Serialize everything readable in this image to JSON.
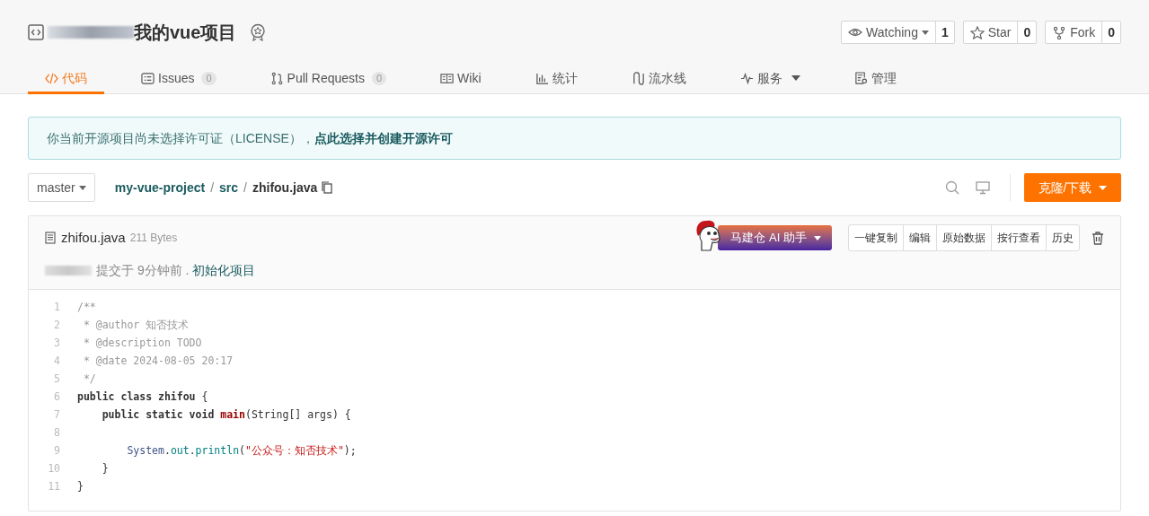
{
  "repo": {
    "title": "我的vue项目",
    "watch": {
      "label": "Watching",
      "count": "1"
    },
    "star": {
      "label": "Star",
      "count": "0"
    },
    "fork": {
      "label": "Fork",
      "count": "0"
    }
  },
  "tabs": [
    {
      "label": "代码",
      "selected": true
    },
    {
      "label": "Issues",
      "count": "0",
      "selected": false
    },
    {
      "label": "Pull Requests",
      "count": "0",
      "selected": false
    },
    {
      "label": "Wiki",
      "selected": false
    },
    {
      "label": "统计",
      "selected": false
    },
    {
      "label": "流水线",
      "selected": false
    },
    {
      "label": "服务",
      "dropdown": true,
      "selected": false
    },
    {
      "label": "管理",
      "selected": false
    }
  ],
  "notice": {
    "text": "你当前开源项目尚未选择许可证（LICENSE），",
    "link": "点此选择并创建开源许可"
  },
  "toolbar": {
    "branch": "master",
    "path": [
      {
        "name": "my-vue-project",
        "separator": "/"
      },
      {
        "name": "src",
        "separator": "/"
      }
    ],
    "file": "zhifou.java",
    "clone": "克隆/下载"
  },
  "file": {
    "name": "zhifou.java",
    "size": "211 Bytes",
    "ai": "马建仓 AI 助手",
    "actions": [
      "一键复制",
      "编辑",
      "原始数据",
      "按行查看",
      "历史"
    ],
    "commit": {
      "time": "提交于 9分钟前 .",
      "message": "初始化项目"
    }
  },
  "code": [
    {
      "number": "1",
      "tokens": [
        {
          "text": "/**",
          "kind": "comment"
        }
      ]
    },
    {
      "number": "2",
      "tokens": [
        {
          "text": " * @author 知否技术",
          "kind": "comment"
        }
      ]
    },
    {
      "number": "3",
      "tokens": [
        {
          "text": " * @description TODO",
          "kind": "comment"
        }
      ]
    },
    {
      "number": "4",
      "tokens": [
        {
          "text": " * @date 2024-08-05 20:17",
          "kind": "comment"
        }
      ]
    },
    {
      "number": "5",
      "tokens": [
        {
          "text": " */",
          "kind": "comment"
        }
      ]
    },
    {
      "number": "6",
      "tokens": [
        {
          "text": "public class zhifou",
          "kind": "keyword"
        },
        {
          "text": " {",
          "kind": "plain"
        }
      ]
    },
    {
      "number": "7",
      "tokens": [
        {
          "text": "    public static void ",
          "kind": "keyword"
        },
        {
          "text": "main",
          "kind": "method"
        },
        {
          "text": "(String[] args) {",
          "kind": "plain"
        }
      ]
    },
    {
      "number": "8"
    },
    {
      "number": "9",
      "tokens": [
        {
          "text": "        System",
          "kind": "type"
        },
        {
          "text": ".",
          "kind": "plain"
        },
        {
          "text": "out",
          "kind": "field"
        },
        {
          "text": ".",
          "kind": "plain"
        },
        {
          "text": "println",
          "kind": "field"
        },
        {
          "text": "(",
          "kind": "plain"
        },
        {
          "text": "\"公众号：知否技术\"",
          "kind": "string"
        },
        {
          "text": ");",
          "kind": "plain"
        }
      ]
    },
    {
      "number": "10",
      "tokens": [
        {
          "text": "    }",
          "kind": "plain"
        }
      ]
    },
    {
      "number": "11",
      "tokens": [
        {
          "text": "}",
          "kind": "plain"
        }
      ]
    }
  ]
}
